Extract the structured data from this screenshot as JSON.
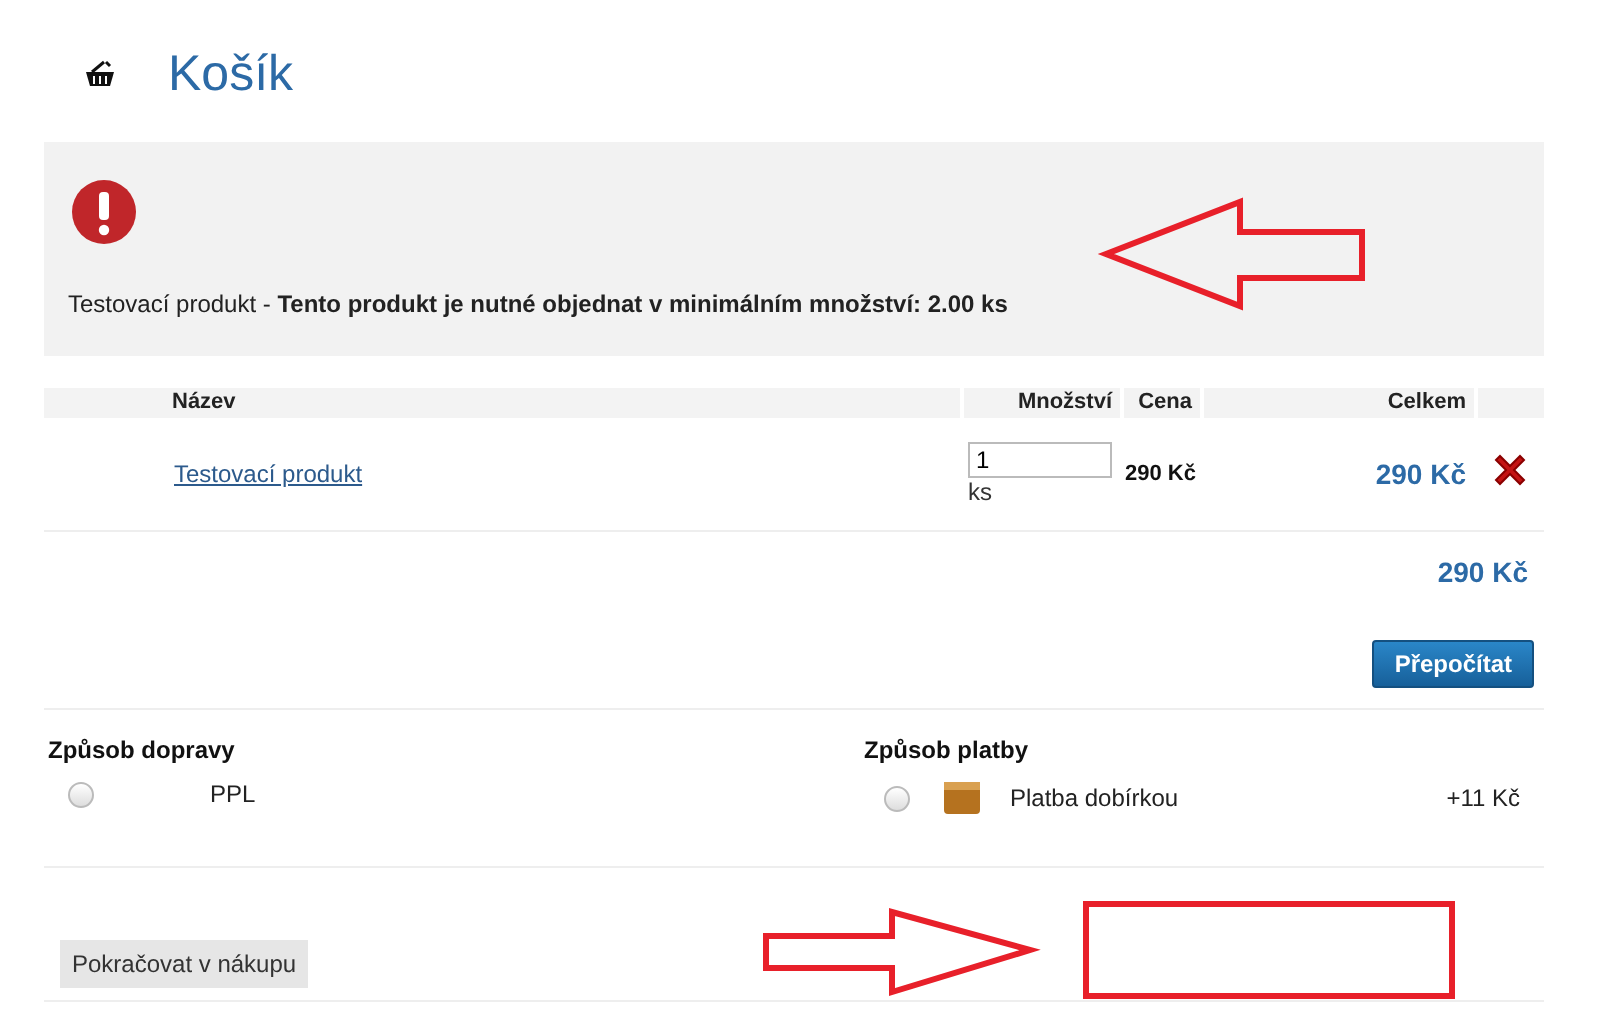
{
  "header": {
    "title": "Košík"
  },
  "alert": {
    "product": "Testovací produkt",
    "separator": " - ",
    "message": "Tento produkt je nutné objednat v minimálním množství: 2.00 ks"
  },
  "table": {
    "columns": [
      "Název",
      "Množství",
      "Cena",
      "Celkem"
    ],
    "rows": [
      {
        "name": "Testovací produkt",
        "quantity": "1",
        "unit": "ks",
        "price": "290 Kč",
        "total": "290 Kč"
      }
    ],
    "sum": "290 Kč"
  },
  "recalculate_button": "Přepočítat",
  "shipping": {
    "title": "Způsob dopravy",
    "options": [
      {
        "label": "PPL",
        "selected": false
      }
    ]
  },
  "payment": {
    "title": "Způsob platby",
    "options": [
      {
        "label": "Platba dobírkou",
        "fee": "+11 Kč",
        "selected": false
      }
    ]
  },
  "continue_button": "Pokračovat v nákupu"
}
